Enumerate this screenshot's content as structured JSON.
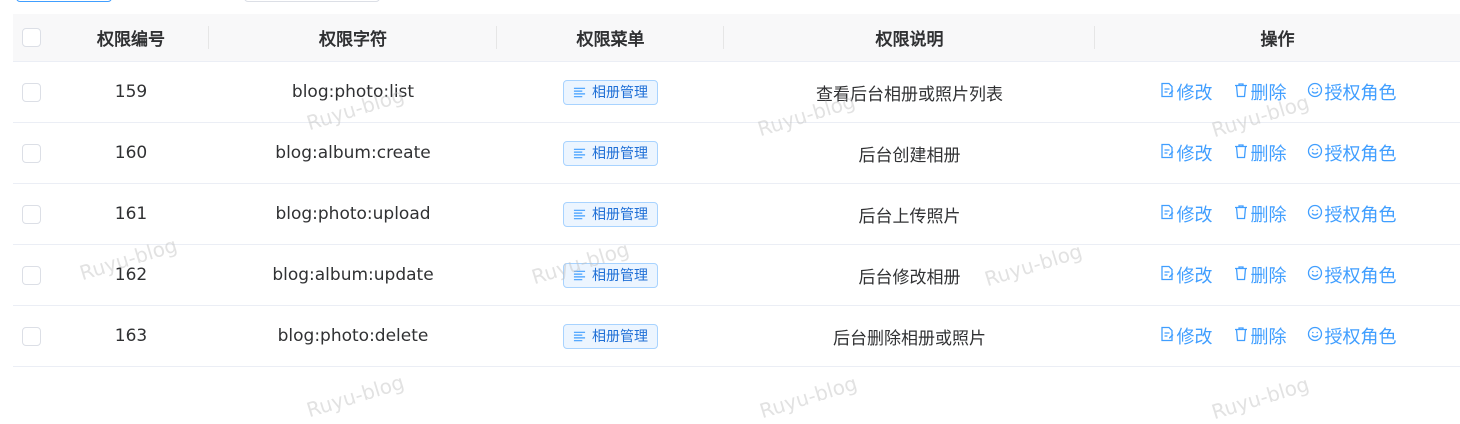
{
  "table": {
    "headers": {
      "id": "权限编号",
      "perm": "权限字符",
      "menu": "权限菜单",
      "desc": "权限说明",
      "ops": "操作"
    },
    "rows": [
      {
        "id": "159",
        "perm": "blog:photo:list",
        "menu": "相册管理",
        "desc": "查看后台相册或照片列表"
      },
      {
        "id": "160",
        "perm": "blog:album:create",
        "menu": "相册管理",
        "desc": "后台创建相册"
      },
      {
        "id": "161",
        "perm": "blog:photo:upload",
        "menu": "相册管理",
        "desc": "后台上传照片"
      },
      {
        "id": "162",
        "perm": "blog:album:update",
        "menu": "相册管理",
        "desc": "后台修改相册"
      },
      {
        "id": "163",
        "perm": "blog:photo:delete",
        "menu": "相册管理",
        "desc": "后台删除相册或照片"
      }
    ],
    "actions": {
      "edit": "修改",
      "delete": "删除",
      "authorize": "授权角色"
    }
  },
  "watermark": "Ruyu-blog",
  "colors": {
    "accent": "#409eff",
    "header_bg": "#f8f8f9",
    "border": "#ebeef5",
    "tag_bg": "#ecf5ff"
  },
  "icons": {
    "tag": "list-icon",
    "edit": "edit-document-icon",
    "delete": "trash-icon",
    "authorize": "smile-user-icon"
  }
}
